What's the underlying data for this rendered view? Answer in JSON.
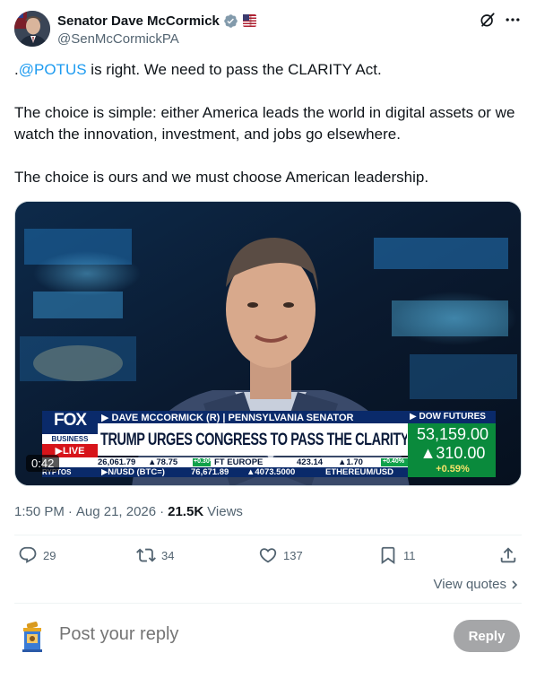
{
  "author": {
    "display_name": "Senator Dave McCormick",
    "handle": "@SenMcCormickPA"
  },
  "tweet": {
    "paragraph1_prefix": ".",
    "mention": "@POTUS",
    "paragraph1_rest": " is right. We need to pass the CLARITY Act.",
    "paragraph2": "The choice is simple: either America leads the world in digital assets or we watch the innovation, investment, and jobs go elsewhere.",
    "paragraph3": "The choice is ours and we must choose American leadership."
  },
  "video": {
    "duration": "0:42",
    "broadcast": {
      "logo_top": "FOX",
      "logo_mid": "BUSINESS",
      "logo_live": "LIVE",
      "lower_third_name": "▶ DAVE MCCORMICK (R) | PENNSYLVANIA SENATOR",
      "headline": "TRUMP URGES CONGRESS TO PASS THE CLARITY ACT",
      "dow_label": "▶ DOW FUTURES",
      "dow_value": "53,159.00",
      "dow_change": "▲310.00",
      "dow_pct": "+0.59%",
      "ticker_row1_a": "26,061.79",
      "ticker_row1_b": "▲78.75",
      "ticker_row1_c": "+0.30%",
      "ticker_row1_d": "FT EUROPE",
      "ticker_row1_e": "423.14",
      "ticker_row1_f": "▲1.70",
      "ticker_row1_g": "+0.40%",
      "ticker_row2_a": "RYPTOS",
      "ticker_row2_b": "▶N/USD (BTC=)",
      "ticker_row2_c": "76,671.89",
      "ticker_row2_d": "▲4073.5000",
      "ticker_row2_e": "ETHEREUM/USD"
    }
  },
  "meta": {
    "time": "1:50 PM",
    "date": "Aug 21, 2026",
    "views_count": "21.5K",
    "views_label": "Views"
  },
  "actions": {
    "replies": "29",
    "reposts": "34",
    "likes": "137",
    "bookmarks": "11"
  },
  "view_quotes": "View quotes",
  "reply": {
    "placeholder": "Post your reply",
    "button": "Reply"
  },
  "colors": {
    "accent": "#1d9bf0",
    "secondary_text": "#536471",
    "verified": "#829aab",
    "fox_red": "#d7141a",
    "ticker_green": "#0fa14a"
  }
}
